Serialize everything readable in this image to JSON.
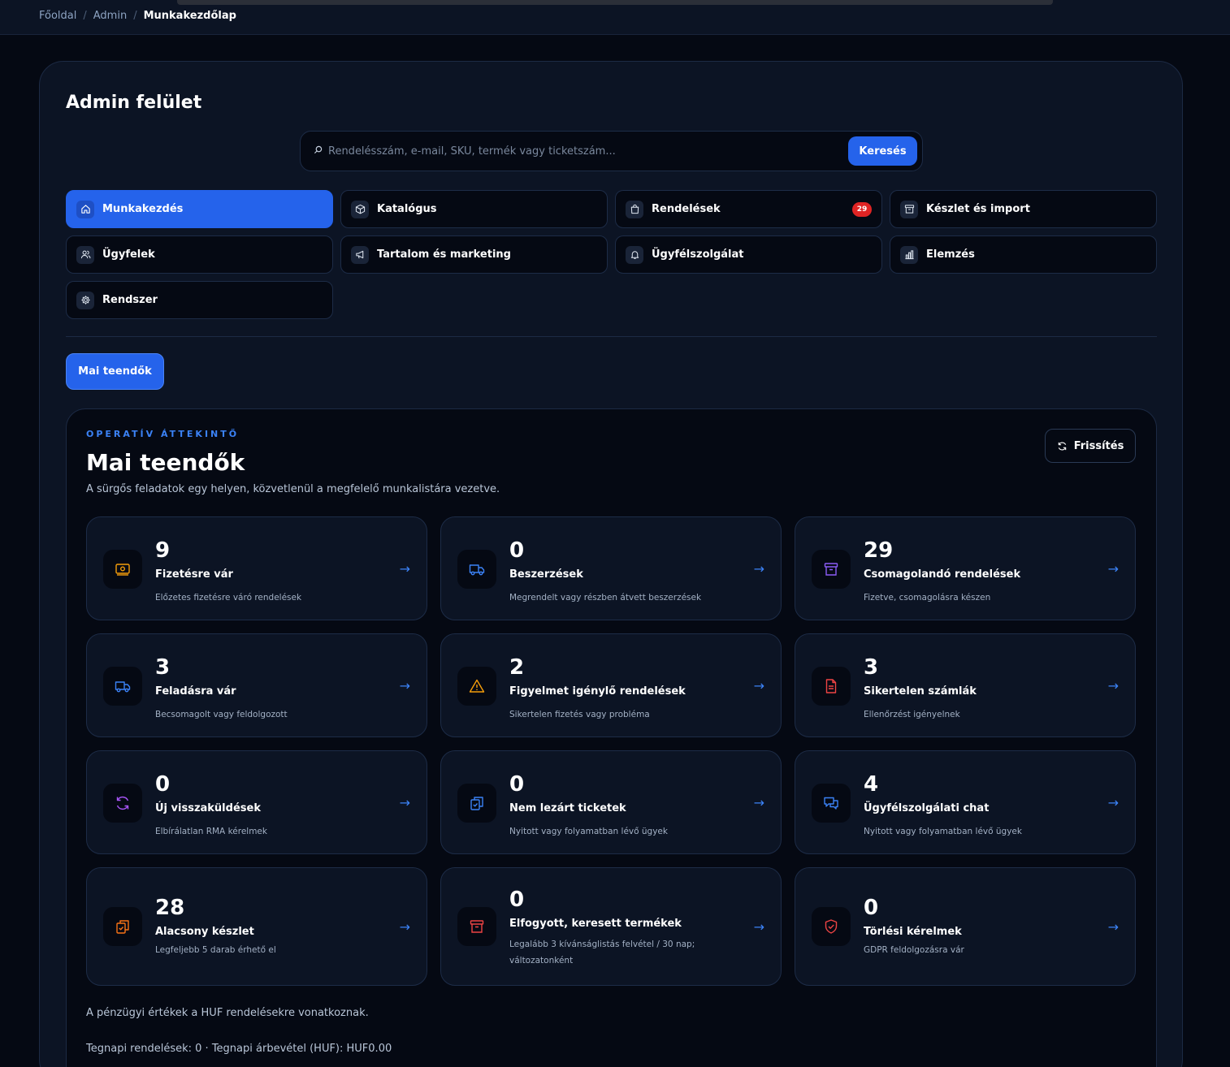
{
  "breadcrumb": [
    "Főoldal",
    "Admin",
    "Munkakezdőlap"
  ],
  "page_title": "Admin felület",
  "search": {
    "placeholder": "Rendelésszám, e-mail, SKU, termék vagy ticketszám...",
    "button": "Keresés"
  },
  "nav": [
    {
      "label": "Munkakezdés",
      "icon": "home-icon",
      "active": true
    },
    {
      "label": "Katalógus",
      "icon": "box-icon"
    },
    {
      "label": "Rendelések",
      "icon": "shopping-bag-icon",
      "badge": "29"
    },
    {
      "label": "Készlet és import",
      "icon": "archive-icon"
    },
    {
      "label": "Ügyfelek",
      "icon": "users-icon"
    },
    {
      "label": "Tartalom és marketing",
      "icon": "megaphone-icon"
    },
    {
      "label": "Ügyfélszolgálat",
      "icon": "bell-icon"
    },
    {
      "label": "Elemzés",
      "icon": "bar-chart-icon"
    },
    {
      "label": "Rendszer",
      "icon": "gear-icon"
    }
  ],
  "today_button": "Mai teendők",
  "overview": {
    "eyebrow": "OPERATÍV ÁTTEKINTŐ",
    "title": "Mai teendők",
    "subtitle": "A sürgős feladatok egy helyen, közvetlenül a megfelelő munkalistára vezetve.",
    "refresh": "Frissítés",
    "cards": [
      {
        "count": "9",
        "title": "Fizetésre vár",
        "desc": "Előzetes fizetésre váró rendelések",
        "icon": "payment-icon",
        "color": "#f59e0b"
      },
      {
        "count": "0",
        "title": "Beszerzések",
        "desc": "Megrendelt vagy részben átvett beszerzések",
        "icon": "truck-icon",
        "color": "#3b82f6"
      },
      {
        "count": "29",
        "title": "Csomagolandó rendelések",
        "desc": "Fizetve, csomagolásra készen",
        "icon": "archive-icon",
        "color": "#8b5cf6"
      },
      {
        "count": "3",
        "title": "Feladásra vár",
        "desc": "Becsomagolt vagy feldolgozott",
        "icon": "truck-icon",
        "color": "#3b82f6"
      },
      {
        "count": "2",
        "title": "Figyelmet igénylő rendelések",
        "desc": "Sikertelen fizetés vagy probléma",
        "icon": "warning-icon",
        "color": "#f59e0b"
      },
      {
        "count": "3",
        "title": "Sikertelen számlák",
        "desc": "Ellenőrzést igényelnek",
        "icon": "document-icon",
        "color": "#ef4444"
      },
      {
        "count": "0",
        "title": "Új visszaküldések",
        "desc": "Elbírálatlan RMA kérelmek",
        "icon": "refresh-icon",
        "color": "#a855f7"
      },
      {
        "count": "0",
        "title": "Nem lezárt ticketek",
        "desc": "Nyitott vagy folyamatban lévő ügyek",
        "icon": "clipboard-icon",
        "color": "#3b82f6"
      },
      {
        "count": "4",
        "title": "Ügyfélszolgálati chat",
        "desc": "Nyitott vagy folyamatban lévő ügyek",
        "icon": "chat-icon",
        "color": "#3b82f6"
      },
      {
        "count": "28",
        "title": "Alacsony készlet",
        "desc": "Legfeljebb 5 darab érhető el",
        "icon": "clipboard-icon",
        "color": "#f97316"
      },
      {
        "count": "0",
        "title": "Elfogyott, keresett termékek",
        "desc": "Legalább 3 kívánságlistás felvétel / 30 nap; változatonként",
        "icon": "archive-icon",
        "color": "#ef4444"
      },
      {
        "count": "0",
        "title": "Törlési kérelmek",
        "desc": "GDPR feldolgozásra vár",
        "icon": "shield-icon",
        "color": "#ef4444"
      }
    ],
    "note_currency": "A pénzügyi értékek a HUF rendelésekre vonatkoznak.",
    "note_yesterday": "Tegnapi rendelések: 0 · Tegnapi árbevétel (HUF): HUF0.00"
  }
}
